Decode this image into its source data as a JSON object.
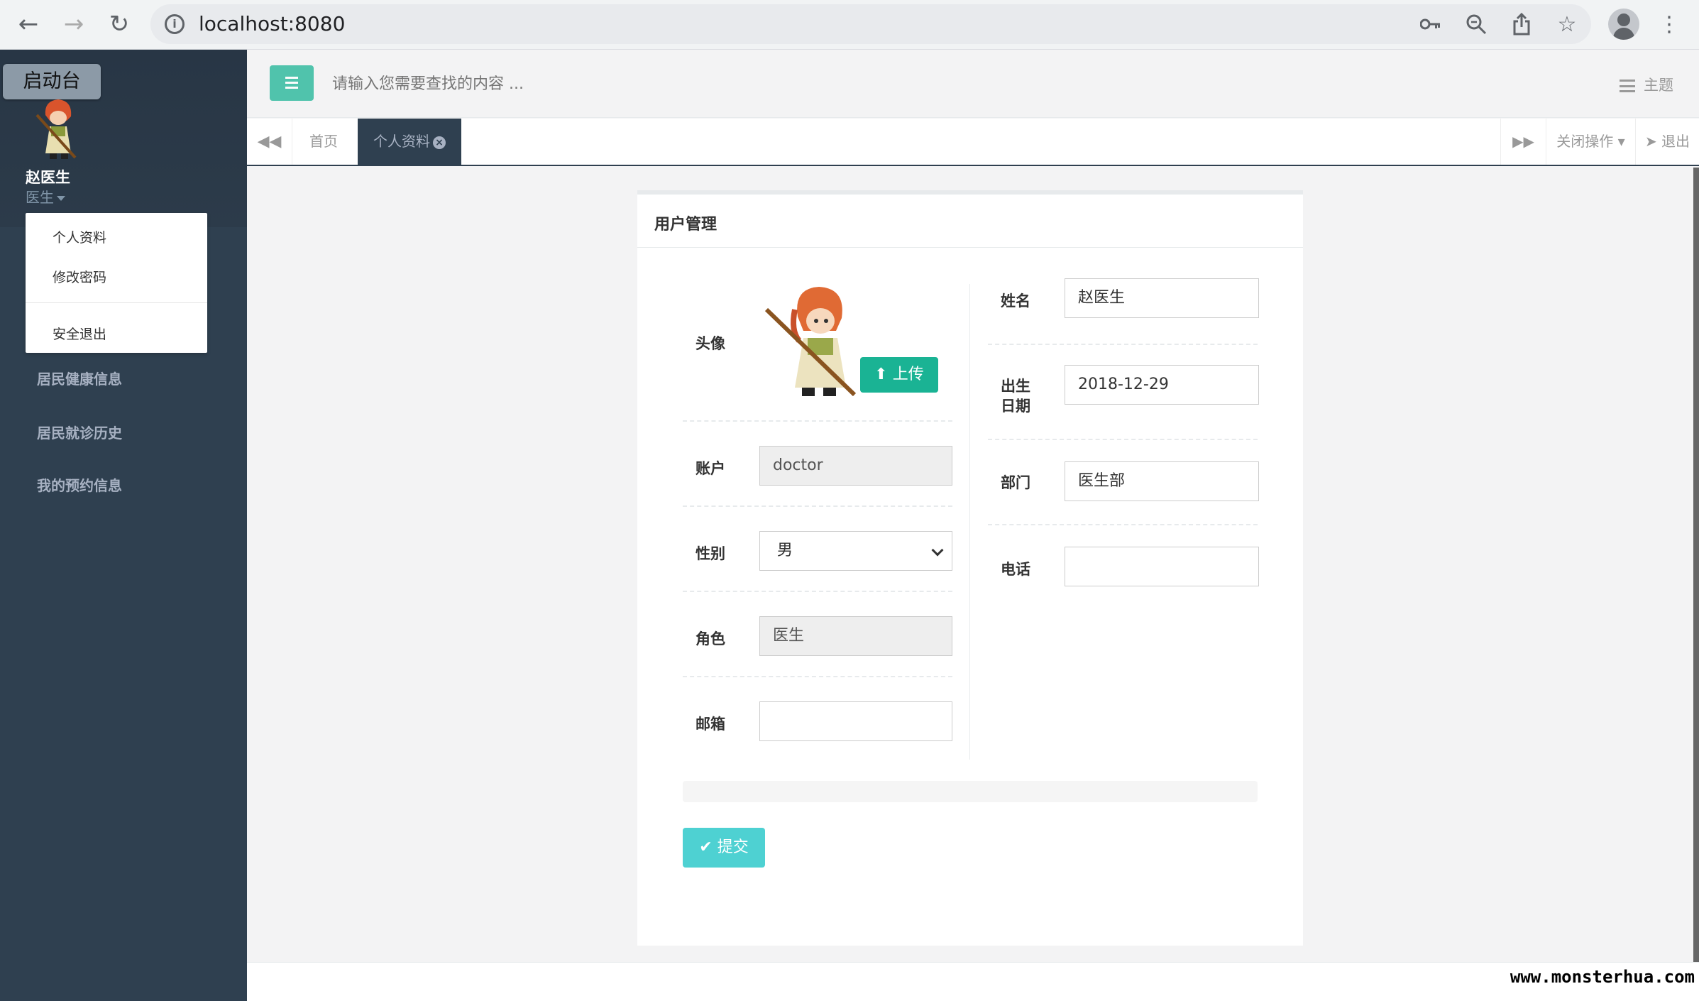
{
  "browser": {
    "url": "localhost:8080",
    "icons": [
      "back-arrow-icon",
      "forward-arrow-icon",
      "reload-icon",
      "info-icon",
      "key-icon",
      "zoom-icon",
      "share-icon",
      "star-icon",
      "profile-icon",
      "more-icon"
    ]
  },
  "sidebar": {
    "launch_label": "启动台",
    "user_name": "赵医生",
    "user_role": "医生",
    "dropdown": [
      "个人资料",
      "修改密码",
      "安全退出"
    ],
    "menu": [
      "居民健康信息",
      "居民就诊历史",
      "我的预约信息"
    ]
  },
  "topbar": {
    "search_placeholder": "请输入您需要查找的内容 ...",
    "theme_label": "主题"
  },
  "tabs": {
    "home": "首页",
    "active": "个人资料",
    "close_ops": "关闭操作",
    "logout": "退出"
  },
  "panel": {
    "title": "用户管理",
    "left": {
      "avatar_label": "头像",
      "upload_label": "上传",
      "account_label": "账户",
      "account_value": "doctor",
      "gender_label": "性别",
      "gender_value": "男",
      "role_label": "角色",
      "role_value": "医生",
      "email_label": "邮箱",
      "email_value": ""
    },
    "right": {
      "name_label": "姓名",
      "name_value": "赵医生",
      "birth_label_1": "出生",
      "birth_label_2": "日期",
      "birth_value": "2018-12-29",
      "dept_label": "部门",
      "dept_value": "医生部",
      "phone_label": "电话",
      "phone_value": ""
    },
    "submit_label": "提交"
  },
  "watermark": "www.monsterhua.com",
  "colors": {
    "sidebar": "#2f4050",
    "primary": "#1ab394",
    "info": "#23c6c8"
  }
}
